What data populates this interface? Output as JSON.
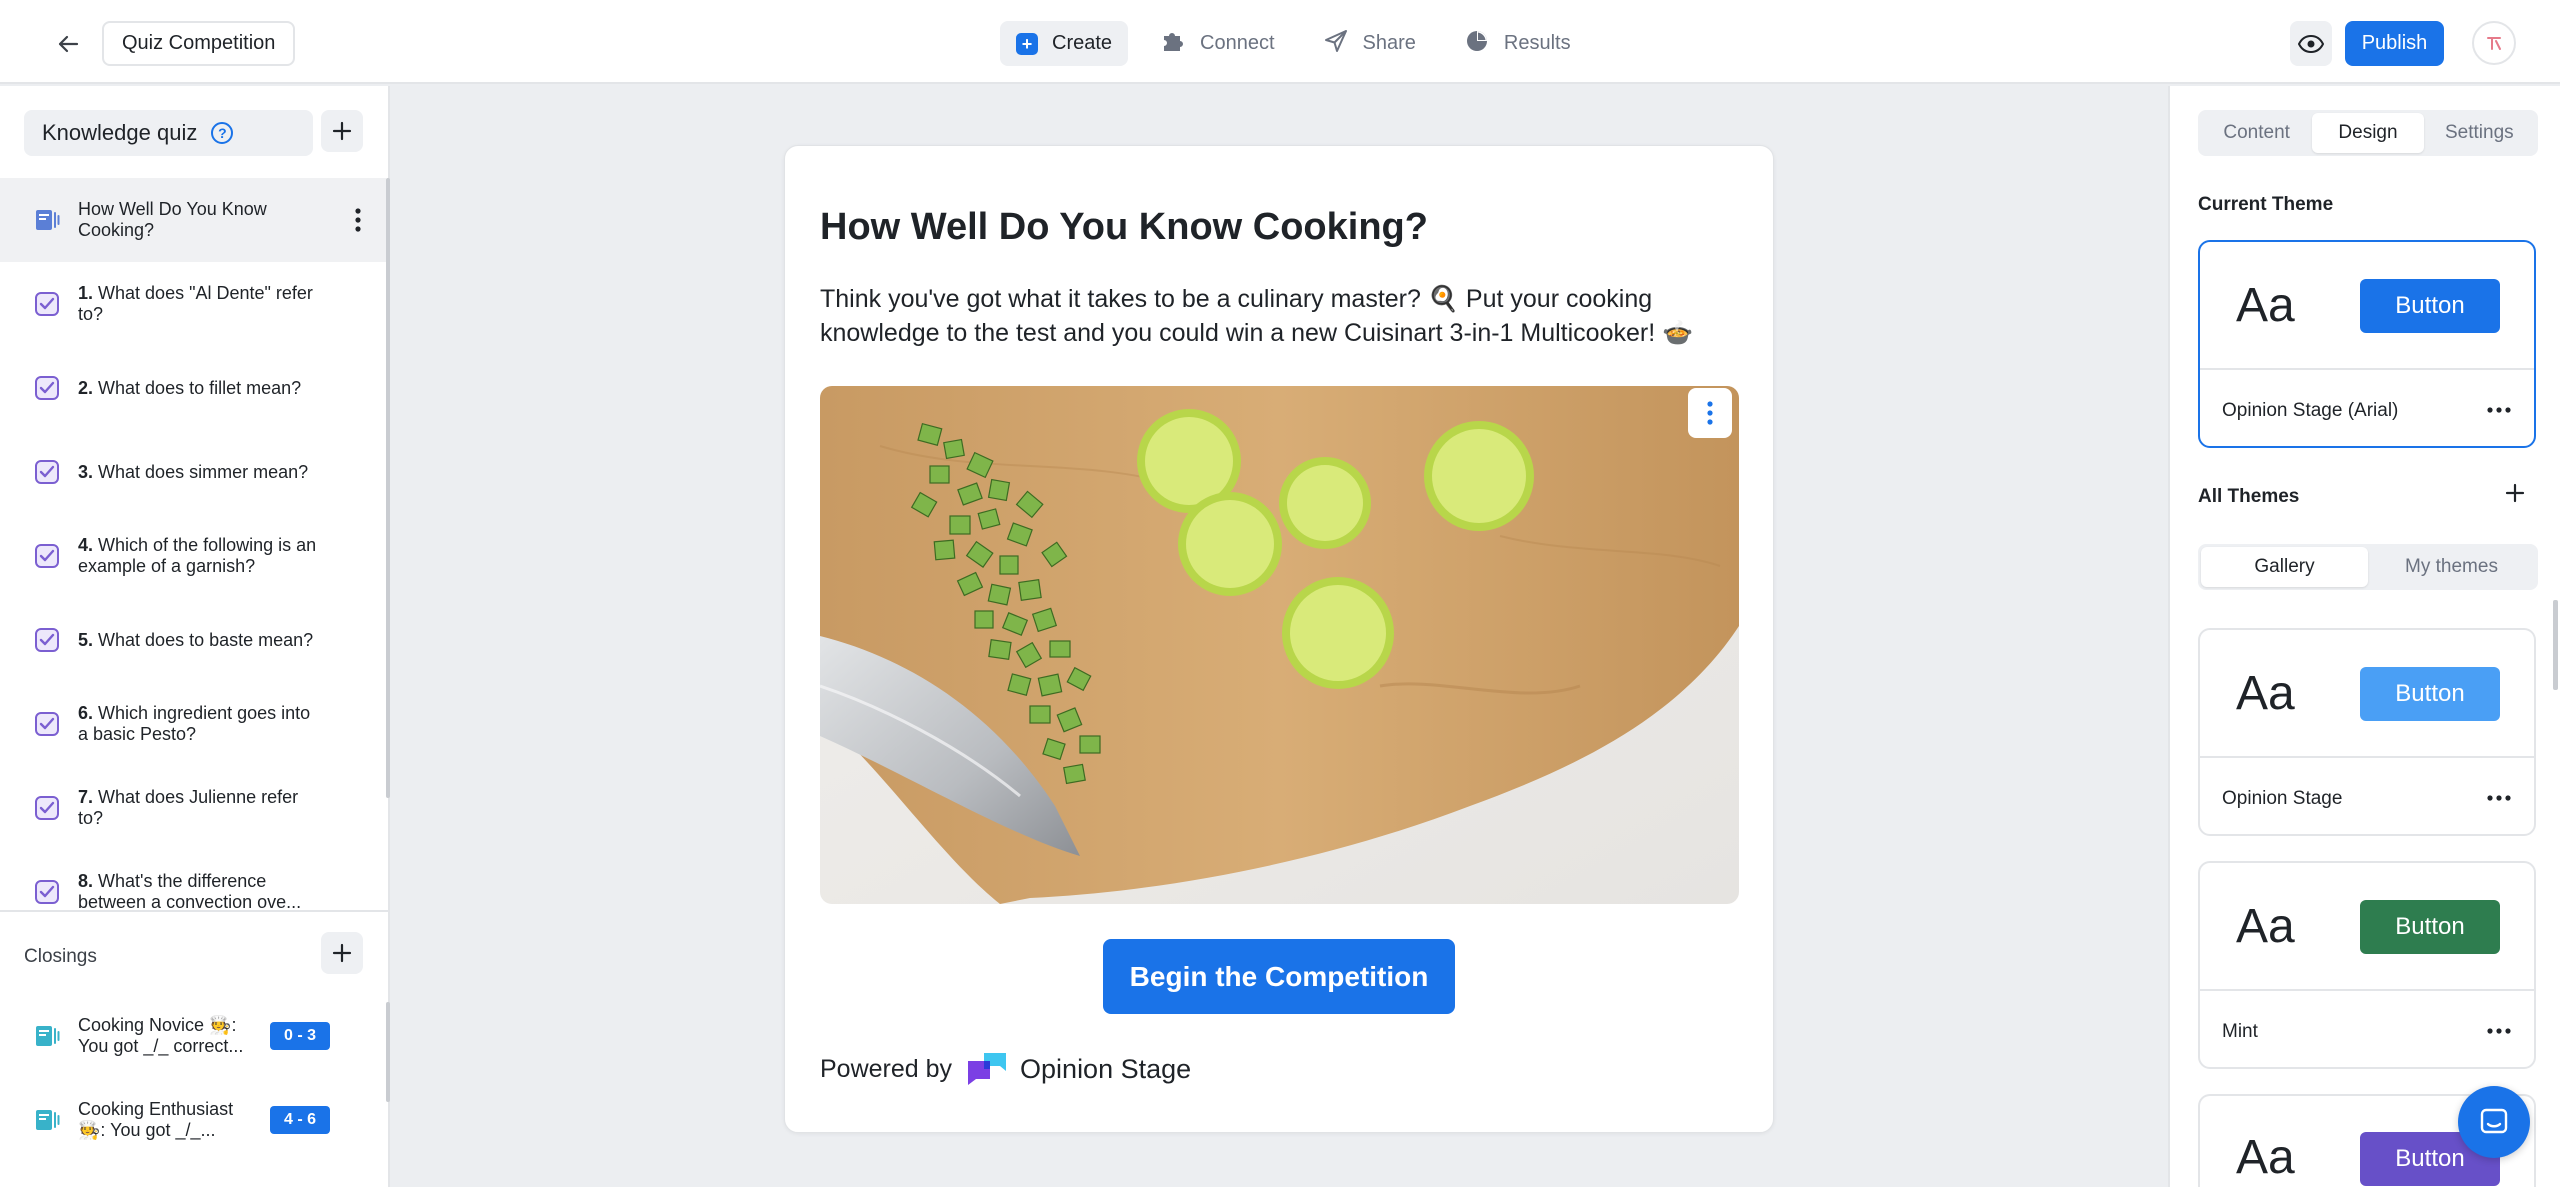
{
  "topbar": {
    "quiz_title": "Quiz Competition",
    "tabs": [
      {
        "label": "Create",
        "icon": "create-icon",
        "active": true
      },
      {
        "label": "Connect",
        "icon": "puzzle-icon",
        "active": false
      },
      {
        "label": "Share",
        "icon": "send-icon",
        "active": false
      },
      {
        "label": "Results",
        "icon": "pie-chart-icon",
        "active": false
      }
    ],
    "publish_label": "Publish",
    "accent": "#1a73e8"
  },
  "left_sidebar": {
    "quiz_type_label": "Knowledge quiz",
    "intro_item": {
      "label": "How Well Do You Know Cooking?",
      "icon": "intro-slide-icon"
    },
    "questions": [
      {
        "num": "1.",
        "label": "What does \"Al Dente\" refer to?"
      },
      {
        "num": "2.",
        "label": "What does to fillet mean?"
      },
      {
        "num": "3.",
        "label": "What does simmer mean?"
      },
      {
        "num": "4.",
        "label": "Which of the following is an example of a garnish?"
      },
      {
        "num": "5.",
        "label": "What does to baste mean?"
      },
      {
        "num": "6.",
        "label": "Which ingredient goes into a basic Pesto?"
      },
      {
        "num": "7.",
        "label": "What does Julienne refer to?"
      },
      {
        "num": "8.",
        "label": "What's the difference between a convection ove..."
      }
    ],
    "closings": {
      "title": "Closings",
      "items": [
        {
          "label": "Cooking Novice 🧑‍🍳: You got _/_ correct...",
          "range": "0 - 3"
        },
        {
          "label": "Cooking Enthusiast 🧑‍🍳: You got _/_...",
          "range": "4 - 6"
        }
      ]
    }
  },
  "canvas": {
    "title": "How Well Do You Know Cooking?",
    "description": "Think you've got what it takes to be a culinary master? 🍳 Put your cooking knowledge to the test and you could win a new Cuisinart 3-in-1 Multicooker! 🍲",
    "start_button": "Begin the Competition",
    "powered_by": "Powered by",
    "brand_name": "Opinion Stage"
  },
  "right_sidebar": {
    "tabs": [
      {
        "label": "Content",
        "active": false
      },
      {
        "label": "Design",
        "active": true
      },
      {
        "label": "Settings",
        "active": false
      }
    ],
    "current_theme_title": "Current Theme",
    "current_theme": {
      "aa": "Aa",
      "button": "Button",
      "name": "Opinion Stage (Arial)",
      "button_color": "#1a73e8"
    },
    "all_themes_title": "All Themes",
    "gallery_tabs": [
      {
        "label": "Gallery",
        "active": true
      },
      {
        "label": "My themes",
        "active": false
      }
    ],
    "themes": [
      {
        "aa": "Aa",
        "button": "Button",
        "name": "Opinion Stage",
        "button_color": "#4a9ff5"
      },
      {
        "aa": "Aa",
        "button": "Button",
        "name": "Mint",
        "button_color": "#2e7d4f"
      },
      {
        "aa": "Aa",
        "button": "Button",
        "name": "",
        "button_color": "#6750c8"
      }
    ]
  }
}
